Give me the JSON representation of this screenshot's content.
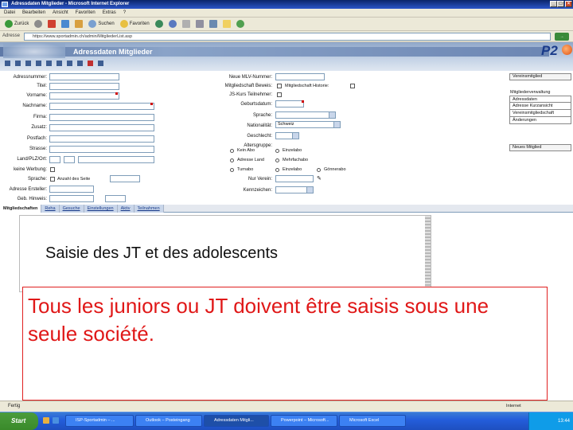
{
  "window": {
    "title": "Adressdaten Mitglieder - Microsoft Internet Explorer",
    "controls": [
      "_",
      "□",
      "×"
    ]
  },
  "menu": [
    "Datei",
    "Bearbeiten",
    "Ansicht",
    "Favoriten",
    "Extras",
    "?"
  ],
  "toolbar": {
    "back": "Zurück",
    "search": "Suchen",
    "favorites": "Favoriten"
  },
  "address": {
    "label": "Adresse",
    "url": "https://www.sportadmin.ch/admin/MitgliederList.asp",
    "go": "Wechseln zu"
  },
  "header": {
    "title": "Adressdaten Mitglieder",
    "logo": "P2"
  },
  "form": {
    "left_labels": [
      "Adressnummer:",
      "Titel:",
      "Vorname:",
      "Nachname:",
      "Firma:",
      "Zusatz:",
      "Postfach:",
      "Strasse:",
      "Land/PLZ/Ort:",
      "keine Werbung:",
      "Sprache:",
      "Adresse Ersteller:",
      "Geb. Hinweis:"
    ],
    "sprache_value": "Anzahl des Seite",
    "mid_labels": [
      "Neue MLV-Nummer:",
      "Mitgliedschaft Beweis:",
      "JS-Kurs Teilnehmer:",
      "Geburtsdatum:",
      "Sprache:",
      "Nationalität:",
      "Geschlecht:",
      "Altersgruppe:",
      "Nur Verein:",
      "Kennzeichen:"
    ],
    "checkbox_label": "Mitgliedschaft Historie:",
    "nationality_value": "Schweiz",
    "radios": [
      [
        "Kein Abo",
        "Einzelabo"
      ],
      [
        "Adresse Land",
        "Mehrfachabo"
      ],
      [
        "Turnabo",
        "Einzelabo",
        "Gönnerabo"
      ]
    ]
  },
  "right_panel": {
    "top_button": "Vereinsmitglied",
    "group_title": "Mitgliederverwaltung",
    "group_items": [
      "Adressdaten",
      "Adresse Kurzansicht",
      "Vereinsmitgliedschaft",
      "Änderungen"
    ],
    "bottom_button": "Neues Mitglied"
  },
  "tabs": [
    "Mitgliedschaften",
    "Reha",
    "Gesuche",
    "Einstellungen",
    "Aktiv",
    "Teilnahmen"
  ],
  "slide": {
    "subtitle": "Saisie des JT et des adolescents",
    "body": "Tous les juniors ou JT doivent être saisis sous une seule société."
  },
  "statusbar": {
    "left": "Fertig",
    "right": "Internet"
  },
  "taskbar": {
    "start": "Start",
    "tasks": [
      "ISP-Sportadmin – ...",
      "Outlook – Posteingang",
      "Adressdaten Mitgli...",
      "Powerpoint – Microsoft...",
      "Microsoft Excel"
    ],
    "clock": "13:44"
  }
}
